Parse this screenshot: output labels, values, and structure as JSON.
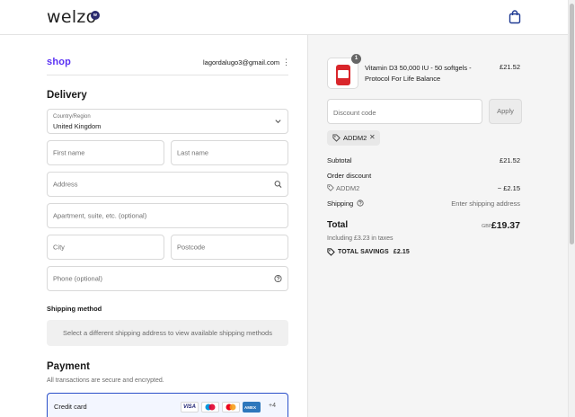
{
  "header": {
    "logo_text": "welzo",
    "logo_badge": "w",
    "cart_icon": "shopping-bag-icon"
  },
  "account": {
    "shop_label": "shop",
    "email": "lagordalugo3@gmail.com",
    "menu_icon": "more-vertical-icon"
  },
  "delivery": {
    "heading": "Delivery",
    "country": {
      "label": "Country/Region",
      "value": "United Kingdom"
    },
    "first_name_placeholder": "First name",
    "last_name_placeholder": "Last name",
    "address_placeholder": "Address",
    "apartment_placeholder": "Apartment, suite, etc. (optional)",
    "city_placeholder": "City",
    "postcode_placeholder": "Postcode",
    "phone_placeholder": "Phone (optional)"
  },
  "shipping_method": {
    "heading": "Shipping method",
    "notice": "Select a different shipping address to view available shipping methods"
  },
  "payment": {
    "heading": "Payment",
    "subtitle": "All transactions are secure and encrypted.",
    "option_label": "Credit card",
    "card_brands": [
      "VISA",
      "Maestro",
      "Mastercard",
      "AMEX"
    ],
    "more_cards": "+4"
  },
  "order": {
    "item": {
      "quantity": "1",
      "title": "Vitamin D3 50,000 IU - 50 softgels - Protocol For Life Balance",
      "price": "£21.52"
    },
    "discount_placeholder": "Discount code",
    "apply_label": "Apply",
    "applied_code": "ADDM2",
    "subtotal_label": "Subtotal",
    "subtotal_value": "£21.52",
    "order_discount_label": "Order discount",
    "discount_code": "ADDM2",
    "discount_value": "− £2.15",
    "shipping_label": "Shipping",
    "shipping_value": "Enter shipping address",
    "total_label": "Total",
    "currency": "GBP",
    "total_value": "£19.37",
    "tax_note": "Including £3.23 in taxes",
    "savings_label": "TOTAL SAVINGS",
    "savings_value": "£2.15"
  },
  "colors": {
    "shop_purple": "#5a31f4",
    "selected_border": "#2a4fc9",
    "summary_bg": "#f5f5f5"
  }
}
